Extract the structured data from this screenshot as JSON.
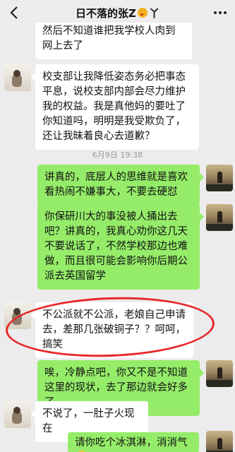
{
  "header": {
    "title": "日不落的张Z",
    "title_suffix": "丫"
  },
  "timestamp": "6月9日 19:38",
  "messages": [
    {
      "side": "in",
      "text": "然后不知道谁把我学校人肉到网上去了"
    },
    {
      "side": "in",
      "text": "校支部让我降低姿态务必把事态平息，说校支部内部会尽力维护我的权益。我是真他妈的要吐了你知道吗，明明是我受欺负了，还让我昧着良心去道歉？"
    },
    {
      "side": "out",
      "text": "讲真的，底层人的思维就是喜欢看热闹不嫌事大，不要去硬怼"
    },
    {
      "side": "out",
      "text": "你保研川大的事没被人捅出去吧？讲真的，我真心劝你这几天不要说话了，不然学校那边也难做，而且很可能会影响你后期公派去英国留学"
    },
    {
      "side": "in",
      "text": "不公派就不公派，老娘自己申请去，差那几张破铜子？？呵呵，搞笑"
    },
    {
      "side": "out",
      "text": "唉，冷静点吧，你又不是不知道这里的现状，去了那边就会好多了"
    },
    {
      "side": "in",
      "text": "不说了，一肚子火现在"
    },
    {
      "side": "out",
      "text": "请你吃个冰淇淋，消消气"
    }
  ],
  "colors": {
    "incoming_bubble": "#ffffff",
    "outgoing_bubble": "#95ec69",
    "highlight_circle": "#e8262a",
    "background": "#ececec"
  }
}
